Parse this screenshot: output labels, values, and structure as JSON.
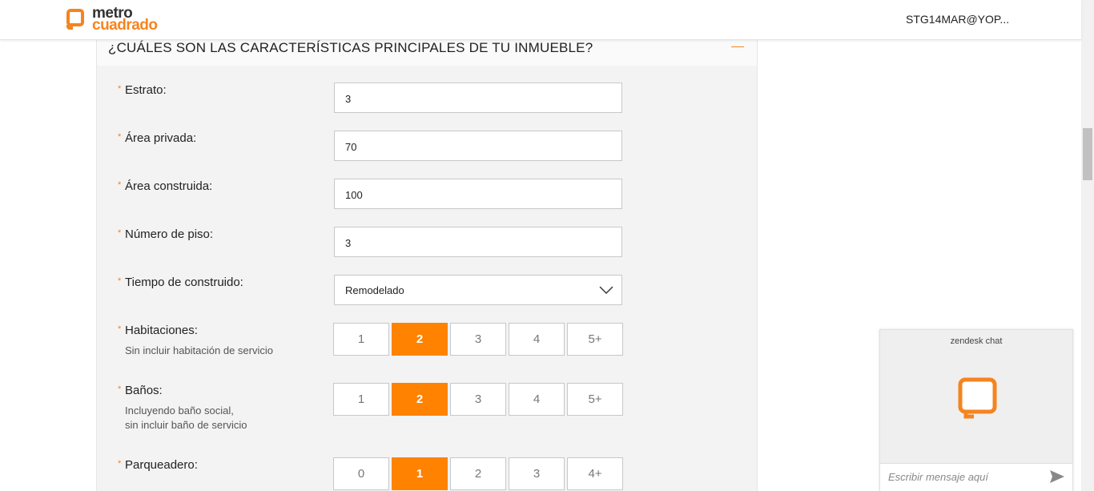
{
  "header": {
    "logo_line1": "metro",
    "logo_line2": "cuadrado",
    "user": "STG14MAR@YOP..."
  },
  "section": {
    "title": "¿CUÁLES SON LAS CARACTERÍSTICAS PRINCIPALES DE TU INMUEBLE?"
  },
  "form": {
    "required_mark": "*",
    "estrato": {
      "label": "Estrato:",
      "value": "3"
    },
    "area_privada": {
      "label": "Área privada:",
      "value": "70"
    },
    "area_construida": {
      "label": "Área construida:",
      "value": "100"
    },
    "numero_piso": {
      "label": "Número de piso:",
      "value": "3"
    },
    "tiempo_construido": {
      "label": "Tiempo de construido:",
      "value": "Remodelado"
    },
    "habitaciones": {
      "label": "Habitaciones:",
      "hint": "Sin incluir habitación de servicio",
      "options": [
        "1",
        "2",
        "3",
        "4",
        "5+"
      ],
      "selected": "2"
    },
    "banos": {
      "label": "Baños:",
      "hint_line1": "Incluyendo baño social,",
      "hint_line2": "sin incluir baño de servicio",
      "options": [
        "1",
        "2",
        "3",
        "4",
        "5+"
      ],
      "selected": "2"
    },
    "parqueadero": {
      "label": "Parqueadero:",
      "options": [
        "0",
        "1",
        "2",
        "3",
        "4+"
      ],
      "selected": "1"
    }
  },
  "chat": {
    "title": "zendesk chat",
    "placeholder": "Escribir mensaje aquí"
  },
  "colors": {
    "accent": "#ff8200",
    "brand": "#f5841f"
  }
}
